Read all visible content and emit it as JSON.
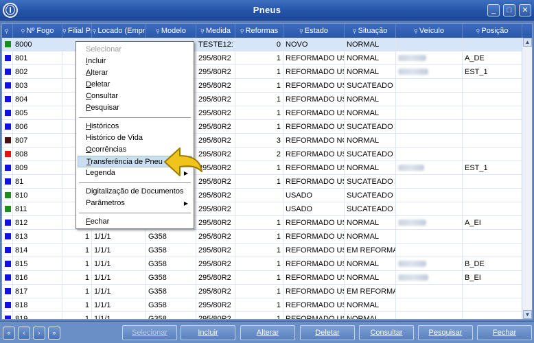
{
  "window": {
    "title": "Pneus",
    "min_glyph": "_",
    "max_glyph": "□",
    "close_glyph": "✕"
  },
  "grid": {
    "columns": [
      {
        "key": "status",
        "label": ""
      },
      {
        "key": "fogo",
        "label": "Nº Fogo"
      },
      {
        "key": "filial",
        "label": "Filial Pn"
      },
      {
        "key": "locado",
        "label": "Locado (Empr"
      },
      {
        "key": "modelo",
        "label": "Modelo"
      },
      {
        "key": "medida",
        "label": "Medida"
      },
      {
        "key": "reformas",
        "label": "Reformas"
      },
      {
        "key": "estado",
        "label": "Estado"
      },
      {
        "key": "situacao",
        "label": "Situação"
      },
      {
        "key": "veiculo",
        "label": "Veículo"
      },
      {
        "key": "posicao",
        "label": "Posição"
      }
    ],
    "rows": [
      {
        "color": "#1e8c1e",
        "fogo": "8000",
        "filial": "",
        "locado": "",
        "modelo": "",
        "medida": "TESTE12:",
        "reformas": "0",
        "estado": "NOVO",
        "situacao": "NORMAL",
        "veiculo_blur": false,
        "posicao": "",
        "selected": true
      },
      {
        "color": "#1010e6",
        "fogo": "801",
        "filial": "",
        "locado": "",
        "modelo": "",
        "medida": "295/80R2",
        "reformas": "1",
        "estado": "REFORMADO US",
        "situacao": "NORMAL",
        "veiculo_blur": true,
        "posicao": "A_DE"
      },
      {
        "color": "#1010e6",
        "fogo": "802",
        "filial": "",
        "locado": "",
        "modelo": "",
        "medida": "295/80R2",
        "reformas": "1",
        "estado": "REFORMADO US",
        "situacao": "NORMAL",
        "veiculo_blur": true,
        "posicao": "EST_1"
      },
      {
        "color": "#1010e6",
        "fogo": "803",
        "filial": "",
        "locado": "",
        "modelo": "",
        "medida": "295/80R2",
        "reformas": "1",
        "estado": "REFORMADO US",
        "situacao": "SUCATEADO",
        "veiculo_blur": false,
        "posicao": ""
      },
      {
        "color": "#1010e6",
        "fogo": "804",
        "filial": "",
        "locado": "",
        "modelo": "",
        "medida": "295/80R2",
        "reformas": "1",
        "estado": "REFORMADO US",
        "situacao": "NORMAL",
        "veiculo_blur": false,
        "posicao": ""
      },
      {
        "color": "#1010e6",
        "fogo": "805",
        "filial": "",
        "locado": "",
        "modelo": "",
        "medida": "295/80R2",
        "reformas": "1",
        "estado": "REFORMADO US",
        "situacao": "NORMAL",
        "veiculo_blur": false,
        "posicao": ""
      },
      {
        "color": "#1010e6",
        "fogo": "806",
        "filial": "",
        "locado": "",
        "modelo": "",
        "medida": "295/80R2",
        "reformas": "1",
        "estado": "REFORMADO US",
        "situacao": "SUCATEADO",
        "veiculo_blur": false,
        "posicao": ""
      },
      {
        "color": "#4a1010",
        "fogo": "807",
        "filial": "",
        "locado": "",
        "modelo": "",
        "medida": "295/80R2",
        "reformas": "3",
        "estado": "REFORMADO NC",
        "situacao": "NORMAL",
        "veiculo_blur": false,
        "posicao": ""
      },
      {
        "color": "#e61010",
        "fogo": "808",
        "filial": "",
        "locado": "",
        "modelo": "",
        "medida": "295/80R2",
        "reformas": "2",
        "estado": "REFORMADO US",
        "situacao": "SUCATEADO",
        "veiculo_blur": false,
        "posicao": ""
      },
      {
        "color": "#1010e6",
        "fogo": "809",
        "filial": "",
        "locado": "",
        "modelo": "",
        "medida": "295/80R2",
        "reformas": "1",
        "estado": "REFORMADO US",
        "situacao": "NORMAL",
        "veiculo_blur": true,
        "posicao": "EST_1"
      },
      {
        "color": "#1010e6",
        "fogo": "81",
        "filial": "",
        "locado": "",
        "modelo": "",
        "medida": "295/80R2",
        "reformas": "1",
        "estado": "REFORMADO US",
        "situacao": "SUCATEADO",
        "veiculo_blur": false,
        "posicao": ""
      },
      {
        "color": "#1e8c1e",
        "fogo": "810",
        "filial": "",
        "locado": "",
        "modelo": "",
        "medida": "295/80R2",
        "reformas": "",
        "estado": "USADO",
        "situacao": "SUCATEADO",
        "veiculo_blur": false,
        "posicao": ""
      },
      {
        "color": "#1e8c1e",
        "fogo": "811",
        "filial": "",
        "locado": "",
        "modelo": "",
        "medida": "295/80R2",
        "reformas": "",
        "estado": "USADO",
        "situacao": "SUCATEADO",
        "veiculo_blur": false,
        "posicao": ""
      },
      {
        "color": "#1010e6",
        "fogo": "812",
        "filial": "",
        "locado": "",
        "modelo": "",
        "medida": "295/80R2",
        "reformas": "1",
        "estado": "REFORMADO US",
        "situacao": "NORMAL",
        "veiculo_blur": true,
        "posicao": "A_EI"
      },
      {
        "color": "#1010e6",
        "fogo": "813",
        "filial": "1",
        "locado": "1/1/1",
        "modelo": "G358",
        "medida": "295/80R2",
        "reformas": "1",
        "estado": "REFORMADO US",
        "situacao": "NORMAL",
        "veiculo_blur": false,
        "posicao": ""
      },
      {
        "color": "#1010e6",
        "fogo": "814",
        "filial": "1",
        "locado": "1/1/1",
        "modelo": "G358",
        "medida": "295/80R2",
        "reformas": "1",
        "estado": "REFORMADO US",
        "situacao": "EM REFORMA",
        "veiculo_blur": false,
        "posicao": ""
      },
      {
        "color": "#1010e6",
        "fogo": "815",
        "filial": "1",
        "locado": "1/1/1",
        "modelo": "G358",
        "medida": "295/80R2",
        "reformas": "1",
        "estado": "REFORMADO US",
        "situacao": "NORMAL",
        "veiculo_blur": true,
        "posicao": "B_DE"
      },
      {
        "color": "#1010e6",
        "fogo": "816",
        "filial": "1",
        "locado": "1/1/1",
        "modelo": "G358",
        "medida": "295/80R2",
        "reformas": "1",
        "estado": "REFORMADO US",
        "situacao": "NORMAL",
        "veiculo_blur": true,
        "posicao": "B_EI"
      },
      {
        "color": "#1010e6",
        "fogo": "817",
        "filial": "1",
        "locado": "1/1/1",
        "modelo": "G358",
        "medida": "295/80R2",
        "reformas": "1",
        "estado": "REFORMADO US",
        "situacao": "EM REFORMA",
        "veiculo_blur": false,
        "posicao": ""
      },
      {
        "color": "#1010e6",
        "fogo": "818",
        "filial": "1",
        "locado": "1/1/1",
        "modelo": "G358",
        "medida": "295/80R2",
        "reformas": "1",
        "estado": "REFORMADO US",
        "situacao": "NORMAL",
        "veiculo_blur": false,
        "posicao": ""
      },
      {
        "color": "#1010e6",
        "fogo": "819",
        "filial": "1",
        "locado": "1/1/1",
        "modelo": "G358",
        "medida": "295/80R2",
        "reformas": "1",
        "estado": "REFORMADO US",
        "situacao": "NORMAL",
        "veiculo_blur": false,
        "posicao": ""
      }
    ]
  },
  "context_menu": {
    "groups": [
      [
        {
          "label": "Selecionar",
          "disabled": true,
          "underline": ""
        },
        {
          "label": "Incluir",
          "underline": "I"
        },
        {
          "label": "Alterar",
          "underline": "A"
        },
        {
          "label": "Deletar",
          "underline": "D"
        },
        {
          "label": "Consultar",
          "underline": "C"
        },
        {
          "label": "Pesquisar",
          "underline": "P"
        }
      ],
      [
        {
          "label": "Históricos",
          "underline": "H"
        },
        {
          "label": "Histórico de Vida",
          "underline": ""
        },
        {
          "label": "Ocorrências",
          "underline": "O"
        },
        {
          "label": "Transferência de Pneu",
          "underline": "T",
          "hover": true
        },
        {
          "label": "Legenda",
          "underline": "",
          "submenu": true
        }
      ],
      [
        {
          "label": "Digitalização de Documentos",
          "underline": ""
        },
        {
          "label": "Parâmetros",
          "underline": "",
          "submenu": true
        }
      ],
      [
        {
          "label": "Fechar",
          "underline": "F"
        }
      ]
    ]
  },
  "toolbar": {
    "nav": [
      "«",
      "‹",
      "›",
      "»"
    ],
    "buttons": [
      {
        "label": "Selecionar",
        "disabled": true
      },
      {
        "label": "Incluir"
      },
      {
        "label": "Alterar"
      },
      {
        "label": "Deletar"
      },
      {
        "label": "Consultar"
      },
      {
        "label": "Pesquisar"
      },
      {
        "label": "Fechar"
      }
    ]
  },
  "colors": {
    "header": "#2a58a9",
    "selected_row": "#d6e5f7",
    "pointer": "#f0c41b"
  },
  "icons": [
    "app-logo-icon",
    "minimize-icon",
    "maximize-icon",
    "close-icon",
    "sort-icon",
    "scroll-up-icon",
    "scroll-down-icon",
    "submenu-arrow-icon",
    "pointer-arrow-icon",
    "first-record-icon",
    "prev-record-icon",
    "next-record-icon",
    "last-record-icon"
  ]
}
